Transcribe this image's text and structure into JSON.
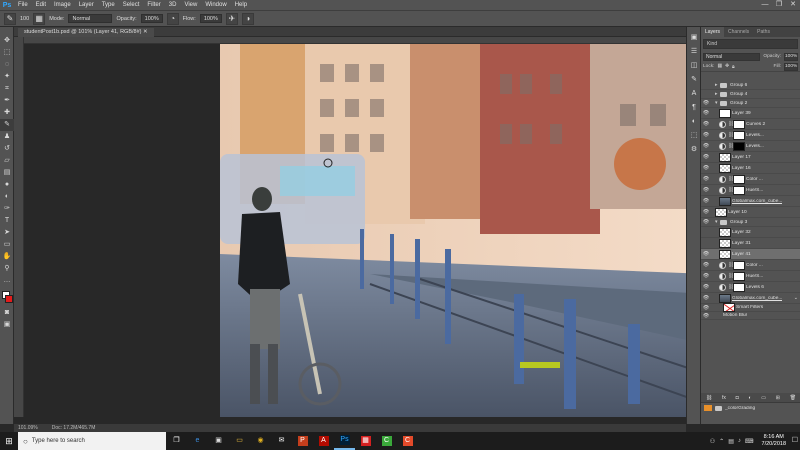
{
  "app": {
    "logo": "Ps",
    "menu": [
      "File",
      "Edit",
      "Image",
      "Layer",
      "Type",
      "Select",
      "Filter",
      "3D",
      "View",
      "Window",
      "Help"
    ],
    "window_controls": [
      "—",
      "❐",
      "✕"
    ]
  },
  "options_bar": {
    "brush_size": "100",
    "mode_label": "Mode:",
    "mode_value": "Normal",
    "opacity_label": "Opacity:",
    "opacity_value": "100%",
    "flow_label": "Flow:",
    "flow_value": "100%"
  },
  "document": {
    "tab_label": "studentPost1b.psd @ 101% (Layer 41, RGB/8#) ✕",
    "zoom": "101.09%",
    "doc_size": "Doc: 17.2M/465.7M"
  },
  "colors": {
    "foreground": "#ffffff",
    "background": "#e31b1b",
    "accent": "#31a8ff"
  },
  "tools": [
    "move-icon",
    "marquee-icon",
    "lasso-icon",
    "quick-select-icon",
    "crop-icon",
    "eyedropper-icon",
    "healing-icon",
    "brush-icon",
    "stamp-icon",
    "history-brush-icon",
    "eraser-icon",
    "gradient-icon",
    "blur-icon",
    "dodge-icon",
    "pen-icon",
    "type-icon",
    "path-select-icon",
    "shape-icon",
    "hand-icon",
    "zoom-icon"
  ],
  "layers_panel": {
    "tabs": [
      "Layers",
      "Channels",
      "Paths"
    ],
    "filter_value": "Kind",
    "blend_mode": "Normal",
    "opacity_label": "Opacity:",
    "opacity_value": "100%",
    "lock_label": "Lock:",
    "fill_label": "Fill:",
    "fill_value": "100%",
    "rows": [
      {
        "kind": "group",
        "name": "Group 6",
        "depth": 1,
        "visible": false
      },
      {
        "kind": "group",
        "name": "Group 4",
        "depth": 1,
        "visible": false
      },
      {
        "kind": "group",
        "name": "Group 2",
        "depth": 1,
        "visible": true,
        "open": true
      },
      {
        "kind": "layer",
        "name": "Layer 39",
        "depth": 2,
        "visible": true,
        "thumb": "white"
      },
      {
        "kind": "adjust",
        "name": "Curves 2",
        "depth": 2,
        "visible": true,
        "thumb": "white"
      },
      {
        "kind": "adjust",
        "name": "Levels...",
        "depth": 2,
        "visible": true,
        "thumb": "white"
      },
      {
        "kind": "adjust",
        "name": "Levels...",
        "depth": 2,
        "visible": true,
        "thumb": "black"
      },
      {
        "kind": "layer",
        "name": "Layer 17",
        "depth": 2,
        "visible": true,
        "thumb": "checker"
      },
      {
        "kind": "layer",
        "name": "Layer 16",
        "depth": 2,
        "visible": true,
        "thumb": "checker"
      },
      {
        "kind": "adjust",
        "name": "Color ...",
        "depth": 2,
        "visible": true,
        "thumb": "white"
      },
      {
        "kind": "adjust",
        "name": "Hue/S...",
        "depth": 2,
        "visible": true,
        "thumb": "white"
      },
      {
        "kind": "layer",
        "name": "Globalmax.com_cube...",
        "depth": 2,
        "visible": true,
        "thumb": "photo",
        "underline": true
      },
      {
        "kind": "layer",
        "name": "Layer 10",
        "depth": 1,
        "visible": true,
        "thumb": "checker"
      },
      {
        "kind": "group",
        "name": "Group 3",
        "depth": 1,
        "visible": true,
        "open": true
      },
      {
        "kind": "layer",
        "name": "Layer 32",
        "depth": 2,
        "visible": false,
        "thumb": "checker"
      },
      {
        "kind": "layer",
        "name": "Layer 31",
        "depth": 2,
        "visible": false,
        "thumb": "checker"
      },
      {
        "kind": "layer",
        "name": "Layer 41",
        "depth": 2,
        "visible": true,
        "thumb": "checker",
        "selected": true
      },
      {
        "kind": "adjust",
        "name": "Color ...",
        "depth": 2,
        "visible": true,
        "thumb": "white"
      },
      {
        "kind": "adjust",
        "name": "Hue/S...",
        "depth": 2,
        "visible": true,
        "thumb": "white"
      },
      {
        "kind": "adjust",
        "name": "Levels 6",
        "depth": 2,
        "visible": true,
        "thumb": "white"
      },
      {
        "kind": "layer",
        "name": "Globalmax.com_cube...",
        "depth": 2,
        "visible": true,
        "thumb": "photo",
        "underline": true,
        "fx": true
      },
      {
        "kind": "sub",
        "name": "Smart Filters",
        "depth": 3,
        "visible": true,
        "thumb": "smart"
      },
      {
        "kind": "sub",
        "name": "Motion Blur",
        "depth": 3,
        "visible": true
      }
    ],
    "footer_icons": [
      "link-icon",
      "fx-icon",
      "mask-icon",
      "adjustment-icon",
      "folder-icon",
      "new-layer-icon",
      "trash-icon"
    ],
    "lower_item": "_colorGrading"
  },
  "taskbar": {
    "search_placeholder": "Type here to search",
    "apps": [
      "task-view-icon",
      "edge-icon",
      "store-icon",
      "explorer-icon",
      "chrome-icon",
      "mail-icon",
      "powerpoint-icon",
      "acrobat-icon",
      "photoshop-icon",
      "app-red-icon",
      "camtasia-icon",
      "recorder-icon"
    ],
    "time": "8:16 AM",
    "date": "7/20/2018"
  }
}
